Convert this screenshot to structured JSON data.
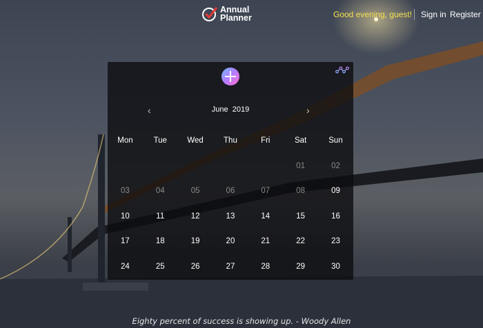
{
  "header": {
    "logo_line1": "Annual",
    "logo_line2": "Planner",
    "greeting": "Good evening, guest!",
    "sign_in": "Sign in",
    "register": "Register"
  },
  "calendar": {
    "month": "June",
    "year": "2019",
    "weekdays": [
      "Mon",
      "Tue",
      "Wed",
      "Thu",
      "Fri",
      "Sat",
      "Sun"
    ],
    "weeks": [
      [
        "",
        "",
        "",
        "",
        "",
        "01",
        "02"
      ],
      [
        "03",
        "04",
        "05",
        "06",
        "07",
        "08",
        "09"
      ],
      [
        "10",
        "11",
        "12",
        "13",
        "14",
        "15",
        "16"
      ],
      [
        "17",
        "18",
        "19",
        "20",
        "21",
        "22",
        "23"
      ],
      [
        "24",
        "25",
        "26",
        "27",
        "28",
        "29",
        "30"
      ]
    ],
    "past_days": [
      "01",
      "02",
      "03",
      "04",
      "05",
      "06",
      "07",
      "08"
    ]
  },
  "icons": {
    "prev": "chevron-left-icon",
    "next": "chevron-right-icon",
    "add": "plus-icon",
    "share": "share-network-icon"
  },
  "colors": {
    "greeting": "#f5e050",
    "accent_gradient": [
      "#6fb8ff",
      "#b57bff",
      "#ff6fcf"
    ]
  },
  "quote": "Eighty percent of success is showing up. - Woody Allen"
}
